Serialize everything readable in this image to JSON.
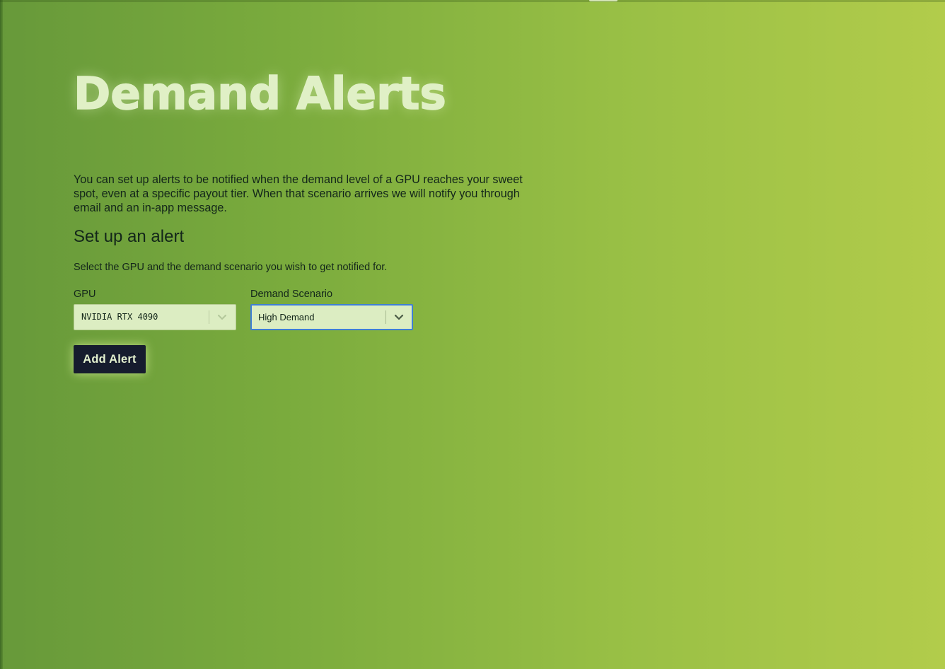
{
  "page": {
    "title": "Demand Alerts",
    "intro": "You can set up alerts to be notified when the demand level of a GPU reaches your sweet spot, even at a specific payout tier. When that scenario arrives we will notify you through email and an in-app message."
  },
  "alert_form": {
    "section_title": "Set up an alert",
    "hint": "Select the GPU and the demand scenario you wish to get notified for.",
    "gpu": {
      "label": "GPU",
      "value": "NVIDIA RTX 4090",
      "icon": "chevron-down-icon"
    },
    "scenario": {
      "label": "Demand Scenario",
      "value": "High Demand",
      "icon": "chevron-down-icon",
      "focused": true
    },
    "add_button_label": "Add Alert"
  },
  "colors": {
    "background_start": "#67993a",
    "background_end": "#b2cc4b",
    "title": "#e0f0c6",
    "text": "#13261a",
    "button_bg": "#161c2e",
    "focus_ring": "#3f7fd6"
  }
}
